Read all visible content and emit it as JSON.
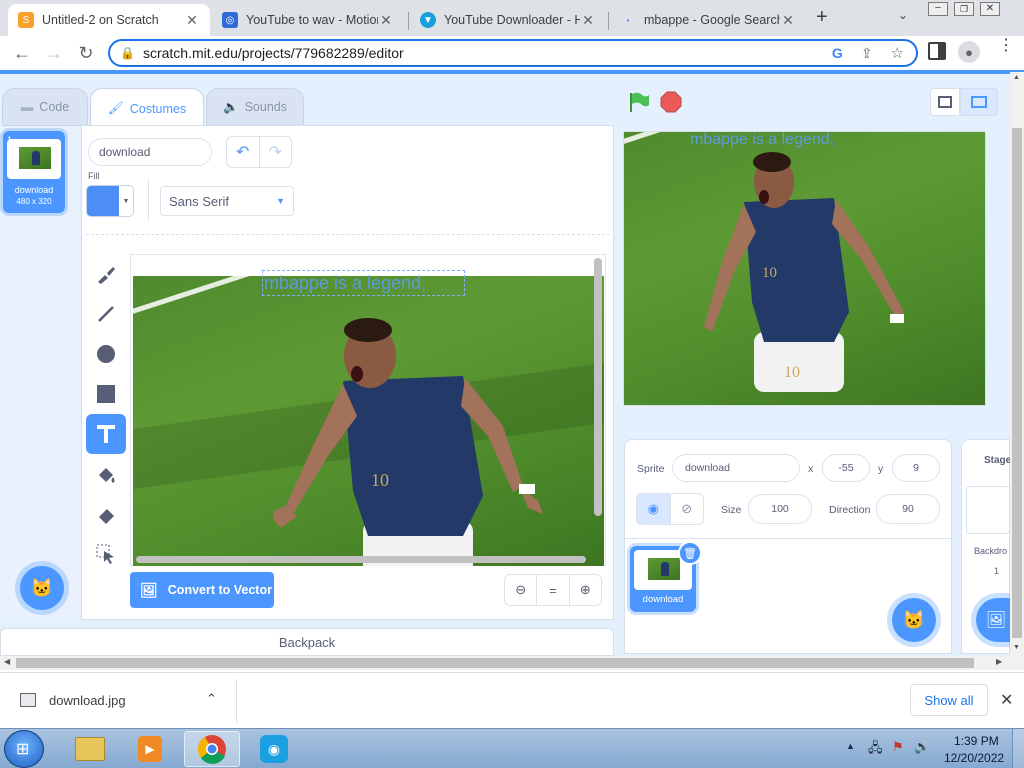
{
  "browser": {
    "tabs": [
      {
        "title": "Untitled-2 on Scratch",
        "favicon": "scratch-favicon",
        "active": true
      },
      {
        "title": "YouTube to wav - Motion",
        "favicon": "motion-favicon"
      },
      {
        "title": "YouTube Downloader - H",
        "favicon": "downloader-favicon"
      },
      {
        "title": "mbappe - Google Search",
        "favicon": "google-favicon"
      }
    ],
    "new_tab_icon": "plus-icon",
    "url": "scratch.mit.edu/projects/779682289/editor"
  },
  "scratch": {
    "tabs": {
      "code": "Code",
      "costumes": "Costumes",
      "sounds": "Sounds"
    },
    "costume_list": [
      {
        "number": "1",
        "name": "download",
        "size": "480 x 320"
      }
    ],
    "costume_name": "download",
    "fill_label": "Fill",
    "fill_color": "#4c8ef5",
    "font": "Sans Serif",
    "canvas_text": "mbappe is a legend,",
    "convert_label": "Convert to Vector",
    "zoom_reset": "=",
    "backpack_label": "Backpack",
    "stage_text": "mbappe is a legend,",
    "sprite_info": {
      "sprite_label": "Sprite",
      "sprite_name": "download",
      "x_label": "x",
      "x": "-55",
      "y_label": "y",
      "y": "9",
      "size_label": "Size",
      "size": "100",
      "direction_label": "Direction",
      "direction": "90"
    },
    "sprites": [
      {
        "name": "download"
      }
    ],
    "stage_panel": {
      "title": "Stage",
      "backdrops_label": "Backdro",
      "count": "1"
    },
    "accent": "#4c97ff"
  },
  "downloads": {
    "file": "download.jpg",
    "show_all": "Show all"
  },
  "taskbar": {
    "time": "1:39 PM",
    "date": "12/20/2022"
  }
}
